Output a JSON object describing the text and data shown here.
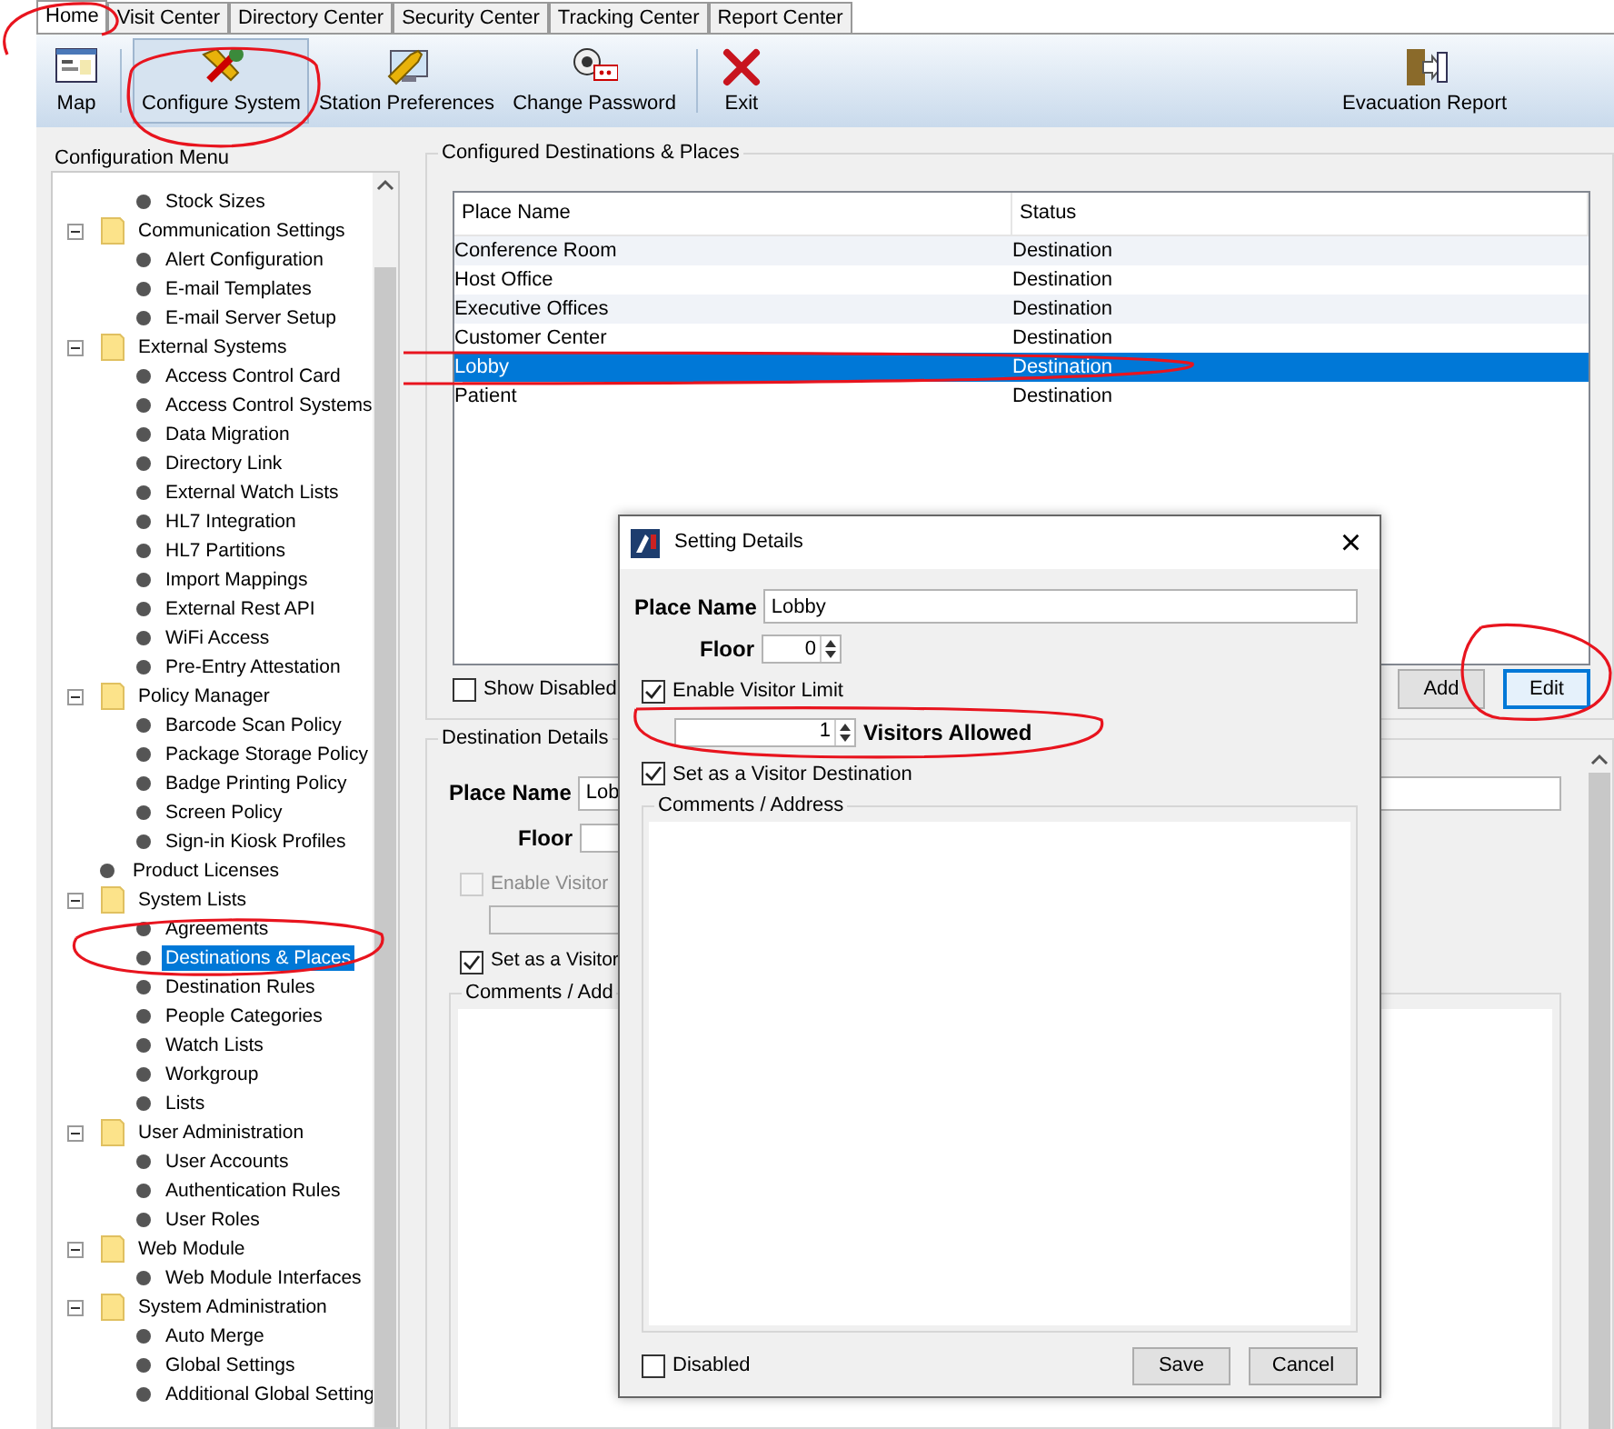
{
  "tabs": [
    {
      "label": "Home",
      "selected": true
    },
    {
      "label": "Visit Center",
      "selected": false
    },
    {
      "label": "Directory Center",
      "selected": false
    },
    {
      "label": "Security Center",
      "selected": false
    },
    {
      "label": "Tracking Center",
      "selected": false
    },
    {
      "label": "Report Center",
      "selected": false
    }
  ],
  "toolbar": [
    {
      "kind": "button",
      "label": "Map",
      "selected": false
    },
    {
      "kind": "separator"
    },
    {
      "kind": "button",
      "label": "Configure System",
      "selected": true
    },
    {
      "kind": "button",
      "label": "Station Preferences",
      "selected": false
    },
    {
      "kind": "button",
      "label": "Change Password",
      "selected": false
    },
    {
      "kind": "separator"
    },
    {
      "kind": "button",
      "label": "Exit",
      "selected": false
    },
    {
      "kind": "spacer"
    },
    {
      "kind": "button",
      "label": "Evacuation Report",
      "selected": false
    }
  ],
  "sidebar": {
    "title": "Configuration Menu",
    "tree": [
      {
        "children": [
          {
            "label": "Stock Sizes",
            "selected": false
          }
        ]
      },
      {
        "label": "Communication Settings",
        "expanded": true,
        "children": [
          {
            "label": "Alert Configuration",
            "selected": false
          },
          {
            "label": "E-mail Templates",
            "selected": false
          },
          {
            "label": "E-mail Server Setup",
            "selected": false
          }
        ]
      },
      {
        "label": "External Systems",
        "expanded": true,
        "children": [
          {
            "label": "Access Control Card",
            "selected": false
          },
          {
            "label": "Access Control Systems",
            "selected": false
          },
          {
            "label": "Data Migration",
            "selected": false
          },
          {
            "label": "Directory Link",
            "selected": false
          },
          {
            "label": "External Watch Lists",
            "selected": false
          },
          {
            "label": "HL7 Integration",
            "selected": false
          },
          {
            "label": "HL7 Partitions",
            "selected": false
          },
          {
            "label": "Import Mappings",
            "selected": false
          },
          {
            "label": "External Rest API",
            "selected": false
          },
          {
            "label": "WiFi Access",
            "selected": false
          },
          {
            "label": "Pre-Entry Attestation",
            "selected": false
          }
        ]
      },
      {
        "label": "Policy Manager",
        "expanded": true,
        "children": [
          {
            "label": "Barcode Scan Policy",
            "selected": false
          },
          {
            "label": "Package Storage Policy",
            "selected": false
          },
          {
            "label": "Badge Printing Policy",
            "selected": false
          },
          {
            "label": "Screen Policy",
            "selected": false
          },
          {
            "label": "Sign-in Kiosk Profiles",
            "selected": false
          }
        ]
      },
      {
        "label": "Product Licenses",
        "selected": false
      },
      {
        "label": "System Lists",
        "expanded": true,
        "children": [
          {
            "label": "Agreements",
            "selected": false
          },
          {
            "label": "Destinations & Places",
            "selected": true
          },
          {
            "label": "Destination Rules",
            "selected": false
          },
          {
            "label": "People Categories",
            "selected": false
          },
          {
            "label": "Watch Lists",
            "selected": false
          },
          {
            "label": "Workgroup",
            "selected": false
          },
          {
            "label": "Lists",
            "selected": false
          }
        ]
      },
      {
        "label": "User Administration",
        "expanded": true,
        "children": [
          {
            "label": "User Accounts",
            "selected": false
          },
          {
            "label": "Authentication Rules",
            "selected": false
          },
          {
            "label": "User Roles",
            "selected": false
          }
        ]
      },
      {
        "label": "Web Module",
        "expanded": true,
        "children": [
          {
            "label": "Web Module Interfaces",
            "selected": false
          }
        ]
      },
      {
        "label": "System Administration",
        "expanded": true,
        "children": [
          {
            "label": "Auto Merge",
            "selected": false
          },
          {
            "label": "Global Settings",
            "selected": false
          },
          {
            "label": "Additional Global Setting",
            "selected": false
          }
        ]
      }
    ]
  },
  "places": {
    "title": "Configured Destinations & Places",
    "columns": [
      "Place Name",
      "Status"
    ],
    "rows": [
      {
        "cells": [
          "Conference Room",
          "Destination"
        ],
        "selected": false
      },
      {
        "cells": [
          "Host Office",
          "Destination"
        ],
        "selected": false
      },
      {
        "cells": [
          "Executive Offices",
          "Destination"
        ],
        "selected": false
      },
      {
        "cells": [
          "Customer Center",
          "Destination"
        ],
        "selected": false
      },
      {
        "cells": [
          "Lobby",
          "Destination"
        ],
        "selected": true
      },
      {
        "cells": [
          "Patient",
          "Destination"
        ],
        "selected": false
      }
    ],
    "show_disabled": {
      "label": "Show Disabled",
      "checked": false
    },
    "buttons": [
      {
        "label": "Add",
        "focused": false
      },
      {
        "label": "Edit",
        "focused": true
      }
    ]
  },
  "details": {
    "title": "Destination Details",
    "place_name_label": "Place Name",
    "place_name_value": "Lob",
    "floor_label": "Floor",
    "enable_visitor": {
      "label": "Enable Visitor",
      "checked": false,
      "disabled": true
    },
    "set_visitor": {
      "label": "Set as a Visitor",
      "checked": true
    },
    "comments_label": "Comments / Add"
  },
  "dialog": {
    "title": "Setting Details",
    "close": "×",
    "place_name_label": "Place Name",
    "place_name_value": "Lobby",
    "floor_label": "Floor",
    "floor_value": "0",
    "enable_limit": {
      "label": "Enable Visitor Limit",
      "checked": true
    },
    "visitors_value": "1",
    "visitors_label": "Visitors Allowed",
    "set_visitor": {
      "label": "Set as a Visitor Destination",
      "checked": true
    },
    "comments_label": "Comments / Address",
    "disabled": {
      "label": "Disabled",
      "checked": false
    },
    "buttons": [
      "Save",
      "Cancel"
    ]
  }
}
